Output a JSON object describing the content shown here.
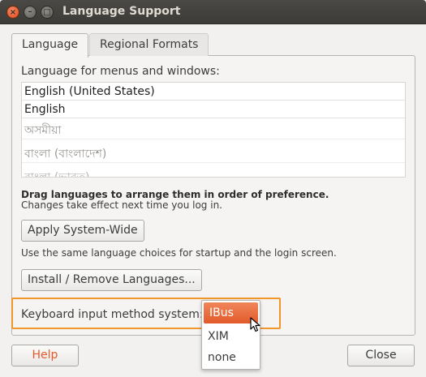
{
  "window": {
    "title": "Language Support",
    "controls": {
      "close": "×",
      "minimize": "–",
      "maximize": "□"
    }
  },
  "tabs": [
    {
      "label": "Language",
      "active": true
    },
    {
      "label": "Regional Formats",
      "active": false
    }
  ],
  "language_section": {
    "label": "Language for menus and windows:",
    "languages": [
      "English (United States)",
      "English",
      "অসমীয়া",
      "বাংলা (বাংলাদেশ)",
      "বাংলা (ভারত)"
    ],
    "drag_hint": "Drag languages to arrange them in order of preference.",
    "drag_note": "Changes take effect next time you log in."
  },
  "buttons": {
    "apply": "Apply System-Wide",
    "apply_note": "Use the same language choices for startup and the login screen.",
    "install": "Install / Remove Languages...",
    "help": "Help",
    "close": "Close"
  },
  "keyboard": {
    "label": "Keyboard input method system:",
    "options": [
      "IBus",
      "XIM",
      "none"
    ],
    "selected": "IBus"
  },
  "colors": {
    "accent": "#e2592a",
    "highlight_border": "#f0962a",
    "titlebar": "#3c3b37"
  }
}
